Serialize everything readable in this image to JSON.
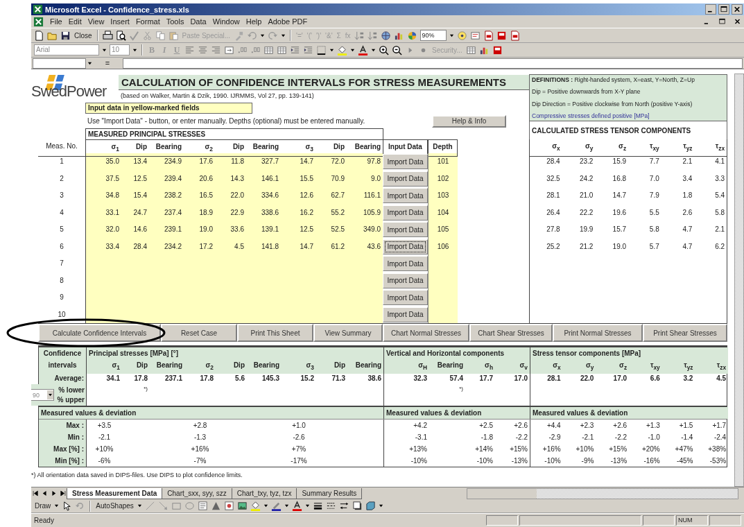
{
  "window": {
    "title": "Microsoft Excel - Confidence_stress.xls"
  },
  "menu": [
    "File",
    "Edit",
    "View",
    "Insert",
    "Format",
    "Tools",
    "Data",
    "Window",
    "Help",
    "Adobe PDF"
  ],
  "toolbar": {
    "close": "Close",
    "paste_special": "Paste Special...",
    "formula_buttons": [
      "'='",
      "'('",
      "')'",
      "'&'",
      "Σ",
      "fx"
    ],
    "zoom": "90%",
    "font": "Arial",
    "font_size": "10",
    "format_buttons": [
      "B",
      "I",
      "U"
    ],
    "security": "Security..."
  },
  "formula_bar": {
    "equals": "="
  },
  "sheet": {
    "logo": "SwedPower",
    "title": "CALCULATION OF CONFIDENCE INTERVALS FOR STRESS MEASUREMENTS",
    "reference": "(based on Walker, Martin & Dzik, 1990. IJRMMS, Vol 27, pp. 139-141)",
    "input_note": "Input data in yellow-marked fields",
    "instructions": "Use \"Import Data\" - button, or enter manually. Depths (optional) must be entered manually.",
    "help_button": "Help & Info",
    "definitions": [
      {
        "text": "**DEFINITIONS :** Right-handed system, X=east, Y=North, Z=Up",
        "kind": "plain"
      },
      {
        "text": "Dip = Positive downwards from X-Y plane",
        "kind": "plain"
      },
      {
        "text": "Dip Direction = Positive clockwise from North (positive Y-axis)",
        "kind": "plain"
      },
      {
        "text": "Compressive stresses defined positive [MPa]",
        "kind": "note"
      }
    ],
    "measured_title": "MEASURED PRINCIPAL STRESSES",
    "calculated_title": "CALCULATED STRESS TENSOR COMPONENTS",
    "measured_columns": [
      "Meas. No.",
      "σ$_{1}$",
      "Dip",
      "Bearing",
      "σ$_{2}$",
      "Dip",
      "Bearing",
      "σ$_{3}$",
      "Dip",
      "Bearing",
      "Input Data",
      "Depth"
    ],
    "calculated_columns": [
      "σ$_{x}$",
      "σ$_{y}$",
      "σ$_{z}$",
      "τ$_{xy}$",
      "τ$_{yz}$",
      "τ$_{zx}$"
    ],
    "rows": [
      {
        "no": "1",
        "values": [
          "35.0",
          "13.4",
          "234.9",
          "17.6",
          "11.8",
          "327.7",
          "14.7",
          "72.0",
          "97.8"
        ],
        "import_button": "Import Data",
        "focused": false,
        "depth": "101",
        "calculated": [
          "28.4",
          "23.2",
          "15.9",
          "7.7",
          "2.1",
          "4.1"
        ]
      },
      {
        "no": "2",
        "values": [
          "37.5",
          "12.5",
          "239.4",
          "20.6",
          "14.3",
          "146.1",
          "15.5",
          "70.9",
          "9.0"
        ],
        "import_button": "Import Data",
        "focused": false,
        "depth": "102",
        "calculated": [
          "32.5",
          "24.2",
          "16.8",
          "7.0",
          "3.4",
          "3.3"
        ]
      },
      {
        "no": "3",
        "values": [
          "34.8",
          "15.4",
          "238.2",
          "16.5",
          "22.0",
          "334.6",
          "12.6",
          "62.7",
          "116.1"
        ],
        "import_button": "Import Data",
        "focused": false,
        "depth": "103",
        "calculated": [
          "28.1",
          "21.0",
          "14.7",
          "7.9",
          "1.8",
          "5.4"
        ]
      },
      {
        "no": "4",
        "values": [
          "33.1",
          "24.7",
          "237.4",
          "18.9",
          "22.9",
          "338.6",
          "16.2",
          "55.2",
          "105.9"
        ],
        "import_button": "Import Data",
        "focused": false,
        "depth": "104",
        "calculated": [
          "26.4",
          "22.2",
          "19.6",
          "5.5",
          "2.6",
          "5.8"
        ]
      },
      {
        "no": "5",
        "values": [
          "32.0",
          "14.6",
          "239.1",
          "19.0",
          "33.6",
          "139.1",
          "12.5",
          "52.5",
          "349.0"
        ],
        "import_button": "Import Data",
        "focused": false,
        "depth": "105",
        "calculated": [
          "27.8",
          "19.9",
          "15.7",
          "5.8",
          "4.7",
          "2.1"
        ]
      },
      {
        "no": "6",
        "values": [
          "33.4",
          "28.4",
          "234.2",
          "17.2",
          "4.5",
          "141.8",
          "14.7",
          "61.2",
          "43.6"
        ],
        "import_button": "Import Data",
        "focused": true,
        "depth": "106",
        "calculated": [
          "25.2",
          "21.2",
          "19.0",
          "5.7",
          "4.7",
          "6.2"
        ]
      },
      {
        "no": "7",
        "import_button": "Import Data",
        "focused": false
      },
      {
        "no": "8",
        "import_button": "Import Data",
        "focused": false
      },
      {
        "no": "9",
        "import_button": "Import Data",
        "focused": false
      },
      {
        "no": "10",
        "import_button": "Import Data",
        "focused": false
      }
    ],
    "buttons": [
      "Calculate Confidence Intervals",
      "Reset Case",
      "Print This Sheet",
      "View Summary",
      "Chart Normal Stresses",
      "Chart Shear Stresses",
      "Print Normal Stresses",
      "Print Shear Stresses"
    ],
    "confidence": {
      "label_top": "Confidence",
      "label_bottom": "intervals",
      "principal_title": "Principal stresses [MPa] [°]",
      "vh_title": "Vertical and Horizontal components",
      "tensor_title": "Stress tensor components [MPa]",
      "principal_columns": [
        "σ$_{1}$",
        "Dip",
        "Bearing",
        "σ$_{2}$",
        "Dip",
        "Bearing",
        "σ$_{3}$",
        "Dip",
        "Bearing"
      ],
      "vh_columns": [
        "σ$_{H}$",
        "Bearing",
        "σ$_{h}$",
        "σ$_{v}$"
      ],
      "tensor_columns": [
        "σ$_{x}$",
        "σ$_{y}$",
        "σ$_{z}$",
        "τ$_{xy}$",
        "τ$_{yz}$",
        "τ$_{zx}$"
      ],
      "average_label": "Average:",
      "average_principal": [
        "34.1",
        "17.8",
        "237.1",
        "17.8",
        "5.6",
        "145.3",
        "15.2",
        "71.3",
        "38.6"
      ],
      "average_vh": [
        "32.3",
        "57.4",
        "17.7",
        "17.0"
      ],
      "average_tensor": [
        "28.1",
        "22.0",
        "17.0",
        "6.6",
        "3.2",
        "4.5"
      ],
      "principal_note": "*)",
      "vh_note": "*)",
      "percent": "90",
      "lower_label": "% lower",
      "upper_label": "% upper",
      "deviation_titles": [
        "Measured values & deviation",
        "Measured values & deviation",
        "Measured values & deviation"
      ],
      "deviation_rows": [
        {
          "label": "Max :",
          "principal": [
            "+3.5",
            "+2.8",
            "+1.0"
          ],
          "vh": [
            "+4.2",
            "+2.5",
            "+2.6"
          ],
          "tensor": [
            "+4.4",
            "+2.3",
            "+2.6",
            "+1.3",
            "+1.5",
            "+1.7"
          ]
        },
        {
          "label": "Min :",
          "principal": [
            "-2.1",
            "-1.3",
            "-2.6"
          ],
          "vh": [
            "-3.1",
            "-1.8",
            "-2.2"
          ],
          "tensor": [
            "-2.9",
            "-2.1",
            "-2.2",
            "-1.0",
            "-1.4",
            "-2.4"
          ]
        },
        {
          "label": "Max [%] :",
          "principal": [
            "+10%",
            "+16%",
            "+7%"
          ],
          "vh": [
            "+13%",
            "+14%",
            "+15%"
          ],
          "tensor": [
            "+16%",
            "+10%",
            "+15%",
            "+20%",
            "+47%",
            "+38%"
          ]
        },
        {
          "label": "Min [%] :",
          "principal": [
            "-6%",
            "-7%",
            "-17%"
          ],
          "vh": [
            "-10%",
            "-10%",
            "-13%"
          ],
          "tensor": [
            "-10%",
            "-9%",
            "-13%",
            "-16%",
            "-45%",
            "-53%"
          ]
        }
      ]
    },
    "footnote": "*) All orientation data saved in DIPS-files. Use DIPS to plot confidence limits."
  },
  "sheet_tabs": [
    {
      "label": "Stress Measurement Data",
      "selected": true
    },
    {
      "label": "Chart_sxx, syy, szz",
      "selected": false
    },
    {
      "label": "Chart_txy, tyz, tzx",
      "selected": false
    },
    {
      "label": "Summary Results",
      "selected": false
    }
  ],
  "drawing_toolbar": {
    "draw": "Draw",
    "autoshapes": "AutoShapes"
  },
  "status_bar": {
    "text": "Ready",
    "num": "NUM"
  }
}
